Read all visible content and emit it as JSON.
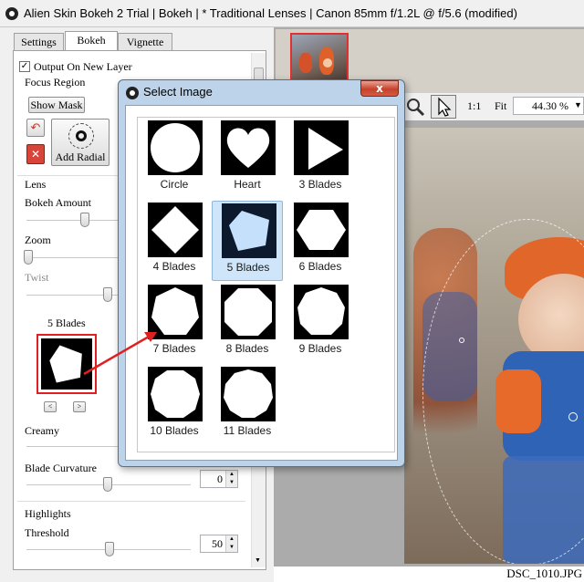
{
  "window": {
    "title": "Alien Skin Bokeh 2 Trial | Bokeh | * Traditional Lenses | Canon  85mm f/1.2L @ f/5.6 (modified)"
  },
  "tabs": [
    {
      "label": "Settings"
    },
    {
      "label": "Bokeh"
    },
    {
      "label": "Vignette"
    }
  ],
  "panel": {
    "output_new_layer": {
      "label": "Output On New Layer",
      "checked": true
    },
    "focus_region": {
      "heading": "Focus Region",
      "show_mask": "Show Mask",
      "add_radial": "Add Radial"
    },
    "lens": {
      "heading": "Lens",
      "bokeh_amount": "Bokeh Amount",
      "zoom": "Zoom",
      "twist": "Twist",
      "shape_label": "5 Blades",
      "prev": "<",
      "next": ">",
      "creamy": "Creamy",
      "blade_curvature": "Blade Curvature",
      "blade_curvature_value": "0"
    },
    "highlights": {
      "heading": "Highlights",
      "threshold": "Threshold",
      "threshold_value": "50"
    }
  },
  "toolbar": {
    "one_to_one": "1:1",
    "fit": "Fit",
    "zoom_value": "44.30 %"
  },
  "status": {
    "filename": "DSC_1010.JPG"
  },
  "dialog": {
    "title": "Select Image",
    "close": "x",
    "items": [
      {
        "label": "Circle"
      },
      {
        "label": "Heart"
      },
      {
        "label": "3 Blades"
      },
      {
        "label": "4 Blades"
      },
      {
        "label": "5 Blades"
      },
      {
        "label": "6 Blades"
      },
      {
        "label": "7 Blades"
      },
      {
        "label": "8 Blades"
      },
      {
        "label": "9 Blades"
      },
      {
        "label": "10 Blades"
      },
      {
        "label": "11 Blades"
      }
    ],
    "selected": "5 Blades"
  },
  "colors": {
    "annotation": "#e02020",
    "selection": "#cfe6fa",
    "dialog_frame": "#bcd3ea"
  }
}
